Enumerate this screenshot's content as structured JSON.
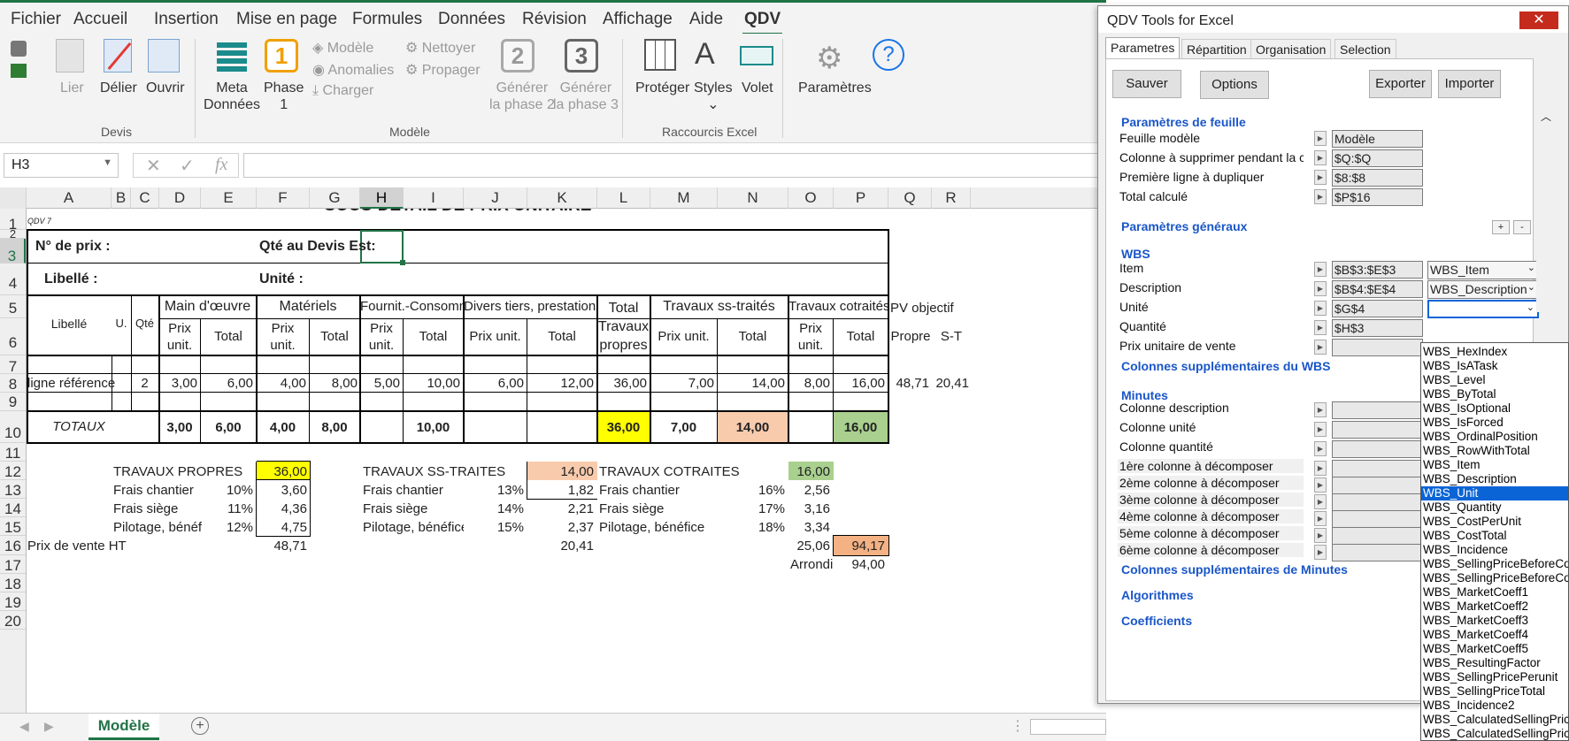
{
  "menu": {
    "tabs": [
      "Fichier",
      "Accueil",
      "Insertion",
      "Mise en page",
      "Formules",
      "Données",
      "Révision",
      "Affichage",
      "Aide",
      "QDV"
    ],
    "active": "QDV"
  },
  "ribbon": {
    "devis": {
      "lier": "Lier",
      "delier": "Délier",
      "ouvrir": "Ouvrir",
      "group": "Devis"
    },
    "modele": {
      "meta": "Meta",
      "donnees": "Données",
      "phase": "Phase",
      "phase_num": "1",
      "phase_sub": "1",
      "modele": "Modèle",
      "anomalies": "Anomalies",
      "charger": "Charger",
      "nettoyer": "Nettoyer",
      "propager": "Propager",
      "gen2_num": "2",
      "gen2_l1": "Générer",
      "gen2_l2": "la phase 2",
      "gen3_num": "3",
      "gen3_l1": "Générer",
      "gen3_l2": "la phase 3",
      "group": "Modèle"
    },
    "raccourcis": {
      "proteger": "Protéger",
      "styles": "Styles",
      "volet": "Volet",
      "group": "Raccourcis Excel"
    },
    "parametres": "Paramètres"
  },
  "formula_bar": {
    "namebox": "H3",
    "fx": "fx",
    "value": ""
  },
  "columns": [
    "A",
    "B",
    "C",
    "D",
    "E",
    "F",
    "G",
    "H",
    "I",
    "J",
    "K",
    "L",
    "M",
    "N",
    "O",
    "P",
    "Q",
    "R"
  ],
  "rows": [
    "1",
    "2",
    "3",
    "4",
    "5",
    "6",
    "7",
    "8",
    "9",
    "10",
    "11",
    "12",
    "13",
    "14",
    "15",
    "16",
    "17",
    "18",
    "19",
    "20"
  ],
  "sheet": {
    "title": "SOUS-DETAIL DE PRIX UNITAIRE",
    "qdv7": "QDV 7",
    "no_prix": "N° de prix :",
    "qte_devis": "Qté au Devis Est:",
    "libelle_lbl": "Libellé :",
    "unite_lbl": "Unité :",
    "h_libelle": "Libellé",
    "h_u": "U.",
    "h_qte": "Qté",
    "h_mo": "Main d'œuvre",
    "h_mat": "Matériels",
    "h_fourn": "Fournit.-Consomm",
    "h_divers": "Divers tiers, prestations",
    "h_total_l1": "Total",
    "h_total_l2": "Travaux",
    "h_total_l3": "propres",
    "h_sstraites": "Travaux ss-traités",
    "h_cotraites": "Travaux cotraités",
    "h_pv": "PV objectif",
    "h_prix1": "Prix",
    "h_prix2": "unit.",
    "h_total": "Total",
    "h_prixunit": "Prix unit.",
    "h_propre": "Propre",
    "h_st": "S-T",
    "row8": {
      "label": "ligne référence",
      "qte": "2",
      "d": "3,00",
      "e": "6,00",
      "f": "4,00",
      "g": "8,00",
      "h": "5,00",
      "i": "10,00",
      "j": "6,00",
      "k": "12,00",
      "l": "36,00",
      "m": "7,00",
      "n": "14,00",
      "o": "8,00",
      "p": "16,00",
      "q": "48,71",
      "r": "20,41"
    },
    "totaux": {
      "label": "TOTAUX",
      "d": "3,00",
      "e": "6,00",
      "f": "4,00",
      "g": "8,00",
      "i": "10,00",
      "l": "36,00",
      "m": "7,00",
      "n": "14,00",
      "p": "16,00"
    },
    "propres": {
      "title": "TRAVAUX PROPRES",
      "total": "36,00",
      "fc": "Frais chantier",
      "fc_pct": "10%",
      "fc_val": "3,60",
      "fs": "Frais siège",
      "fs_pct": "11%",
      "fs_val": "4,36",
      "pb": "Pilotage, bénéf",
      "pb_pct": "12%",
      "pb_val": "4,75"
    },
    "sstraites": {
      "title": "TRAVAUX SS-TRAITES",
      "total": "14,00",
      "fc": "Frais chantier",
      "fc_pct": "13%",
      "fc_val": "1,82",
      "fs": "Frais siège",
      "fs_pct": "14%",
      "fs_val": "2,21",
      "pb": "Pilotage, bénéfice",
      "pb_pct": "15%",
      "pb_val": "2,37"
    },
    "cotraites": {
      "title": "TRAVAUX COTRAITES",
      "total": "16,00",
      "fc": "Frais chantier",
      "fc_pct": "16%",
      "fc_val": "2,56",
      "fs": "Frais siège",
      "fs_pct": "17%",
      "fs_val": "3,16",
      "pb": "Pilotage, bénéfice",
      "pb_pct": "18%",
      "pb_val": "3,34"
    },
    "pvht": {
      "label": "Prix de vente HT",
      "f": "48,71",
      "k": "20,41",
      "o": "25,06",
      "p": "94,17"
    },
    "arrondi": {
      "label": "Arrondi",
      "value": "94,00"
    }
  },
  "sheet_tab": "Modèle",
  "panel": {
    "title": "QDV Tools for Excel",
    "tabs": [
      "Parametres",
      "Répartition",
      "Organisation",
      "Selection"
    ],
    "buttons": {
      "sauver": "Sauver",
      "options": "Options",
      "exporter": "Exporter",
      "importer": "Importer"
    },
    "sec_feuille": "Paramètres de feuille",
    "feuille": [
      {
        "label": "Feuille modèle",
        "value": "Modèle"
      },
      {
        "label": "Colonne à supprimer pendant la co",
        "value": "$Q:$Q"
      },
      {
        "label": "Première ligne à dupliquer",
        "value": "$8:$8"
      },
      {
        "label": "Total calculé",
        "value": "$P$16"
      }
    ],
    "sec_generaux": "Paramètres généraux",
    "plus": "+",
    "minus": "-",
    "sec_wbs": "WBS",
    "wbs": [
      {
        "label": "Item",
        "value": "$B$3:$E$3",
        "combo": "WBS_Item"
      },
      {
        "label": "Description",
        "value": "$B$4:$E$4",
        "combo": "WBS_Description"
      },
      {
        "label": "Unité",
        "value": "$G$4",
        "combo": ""
      },
      {
        "label": "Quantité",
        "value": "$H$3"
      },
      {
        "label": "Prix unitaire de vente",
        "value": ""
      }
    ],
    "sec_wbs_cols": "Colonnes supplémentaires du WBS",
    "sec_minutes": "Minutes",
    "minutes": [
      {
        "label": "Colonne description"
      },
      {
        "label": "Colonne unité"
      },
      {
        "label": "Colonne quantité"
      },
      {
        "label": "1ère colonne à décomposer"
      },
      {
        "label": "2ème colonne à décomposer"
      },
      {
        "label": "3ème colonne à décomposer"
      },
      {
        "label": "4ème colonne à décomposer"
      },
      {
        "label": "5ème colonne à décomposer"
      },
      {
        "label": "6ème colonne à décomposer"
      }
    ],
    "sec_min_cols": "Colonnes supplémentaires de Minutes",
    "sec_algo": "Algorithmes",
    "sec_coef": "Coefficients"
  },
  "dropdown": {
    "selected": "WBS_Unit",
    "items": [
      "WBS_HexIndex",
      "WBS_IsATask",
      "WBS_Level",
      "WBS_ByTotal",
      "WBS_IsOptional",
      "WBS_IsForced",
      "WBS_OrdinalPosition",
      "WBS_RowWithTotal",
      "WBS_Item",
      "WBS_Description",
      "WBS_Unit",
      "WBS_Quantity",
      "WBS_CostPerUnit",
      "WBS_CostTotal",
      "WBS_Incidence",
      "WBS_SellingPriceBeforeCo",
      "WBS_SellingPriceBeforeCo",
      "WBS_MarketCoeff1",
      "WBS_MarketCoeff2",
      "WBS_MarketCoeff3",
      "WBS_MarketCoeff4",
      "WBS_MarketCoeff5",
      "WBS_ResultingFactor",
      "WBS_SellingPricePerunit",
      "WBS_SellingPriceTotal",
      "WBS_Incidence2",
      "WBS_CalculatedSellingPric",
      "WBS_CalculatedSellingPric"
    ]
  },
  "colors": {
    "excel_green": "#217346",
    "selection_blue": "#0a64d6",
    "section_blue": "#1a56c8",
    "yellow": "#ffff00",
    "peach": "#f8cbad",
    "green": "#a9d08e",
    "orange": "#f4b183"
  }
}
